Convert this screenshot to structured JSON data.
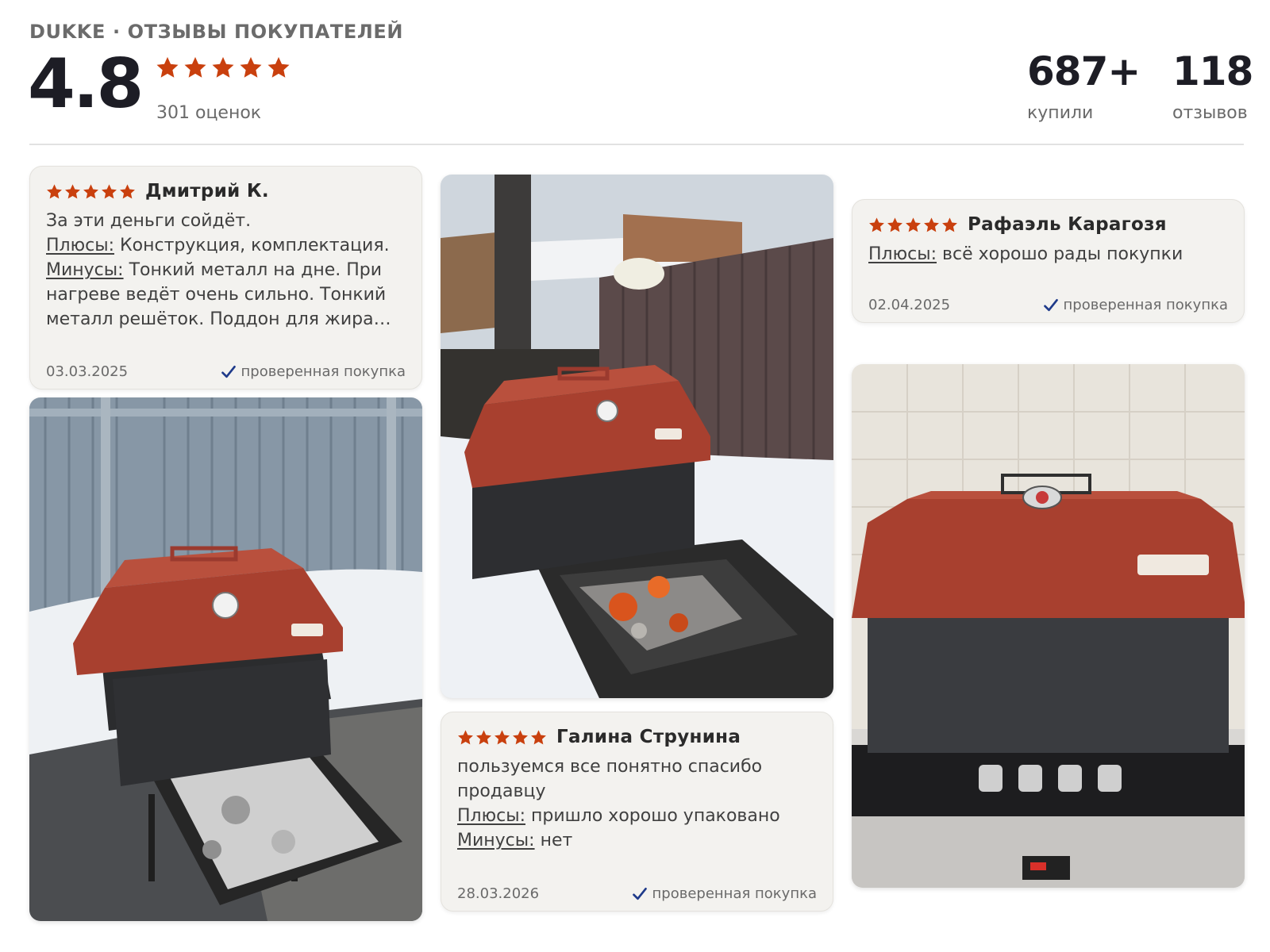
{
  "header": {
    "brand_line": "DUKKE · ОТЗЫВЫ ПОКУПАТЕЛЕЙ",
    "rating": "4.8",
    "stars": 5,
    "ratings_count": "301 оценок",
    "stats": [
      {
        "value": "687+",
        "label": "купили"
      },
      {
        "value": "118",
        "label": "отзывов"
      }
    ]
  },
  "reviews": [
    {
      "name": "Дмитрий К.",
      "stars": 5,
      "text": "За эти деньги сойдёт.",
      "pros_label": "Плюсы:",
      "pros": "Конструкция, комплектация.",
      "cons_label": "Минусы:",
      "cons": "Тонкий металл на дне. При нагреве ведёт очень сильно. Тонкий металл решёток. Поддон для жира…",
      "date": "03.03.2025",
      "verified": "проверенная покупка"
    },
    {
      "name": "Рафаэль Карагозя",
      "stars": 5,
      "pros_label": "Плюсы:",
      "pros": "всё хорошо рады покупки",
      "date": "02.04.2025",
      "verified": "проверенная покупка"
    },
    {
      "name": "Галина Струнина",
      "stars": 5,
      "text": "пользуемся все понятно спасибо продавцу",
      "pros_label": "Плюсы:",
      "pros": "пришло хорошо упаковано",
      "cons_label": "Минусы:",
      "cons": "нет",
      "date": "28.03.2026",
      "verified": "проверенная покупка"
    }
  ],
  "colors": {
    "star": "#c9400e",
    "check": "#1e3a8a",
    "card_bg": "#f3f2ef",
    "smoker_lid": "#a8402f"
  }
}
